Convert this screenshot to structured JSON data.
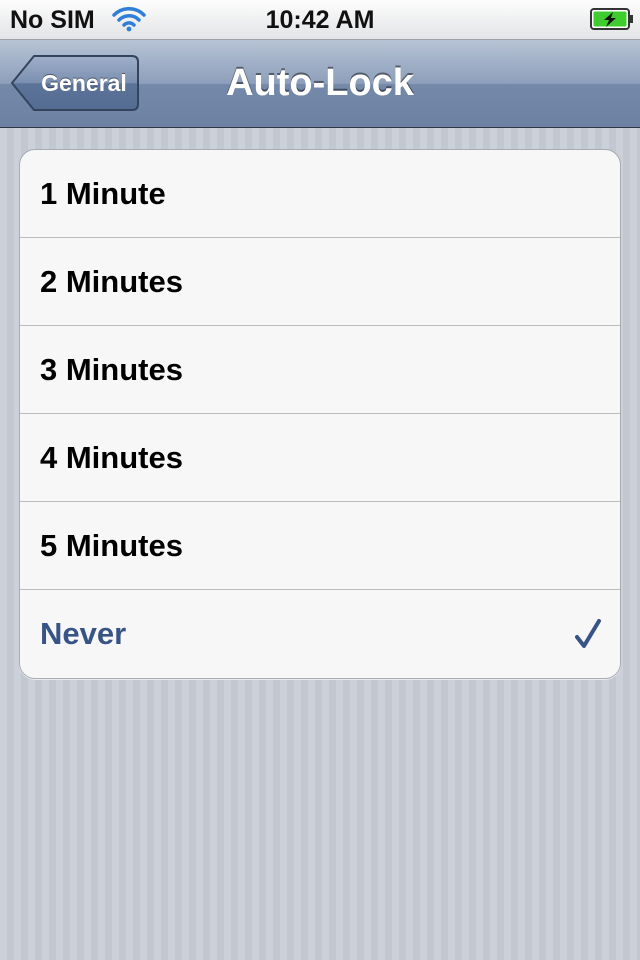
{
  "status_bar": {
    "carrier": "No SIM",
    "time": "10:42 AM",
    "wifi_icon": "wifi-icon",
    "battery_icon": "battery-charging-icon"
  },
  "nav_bar": {
    "back_label": "General",
    "title": "Auto-Lock"
  },
  "options": [
    {
      "label": "1 Minute",
      "selected": false
    },
    {
      "label": "2 Minutes",
      "selected": false
    },
    {
      "label": "3 Minutes",
      "selected": false
    },
    {
      "label": "4 Minutes",
      "selected": false
    },
    {
      "label": "5 Minutes",
      "selected": false
    },
    {
      "label": "Never",
      "selected": true
    }
  ],
  "colors": {
    "selected_text": "#385487",
    "nav_bar": "#8d9fbb",
    "battery_fill": "#3fcc2f"
  }
}
